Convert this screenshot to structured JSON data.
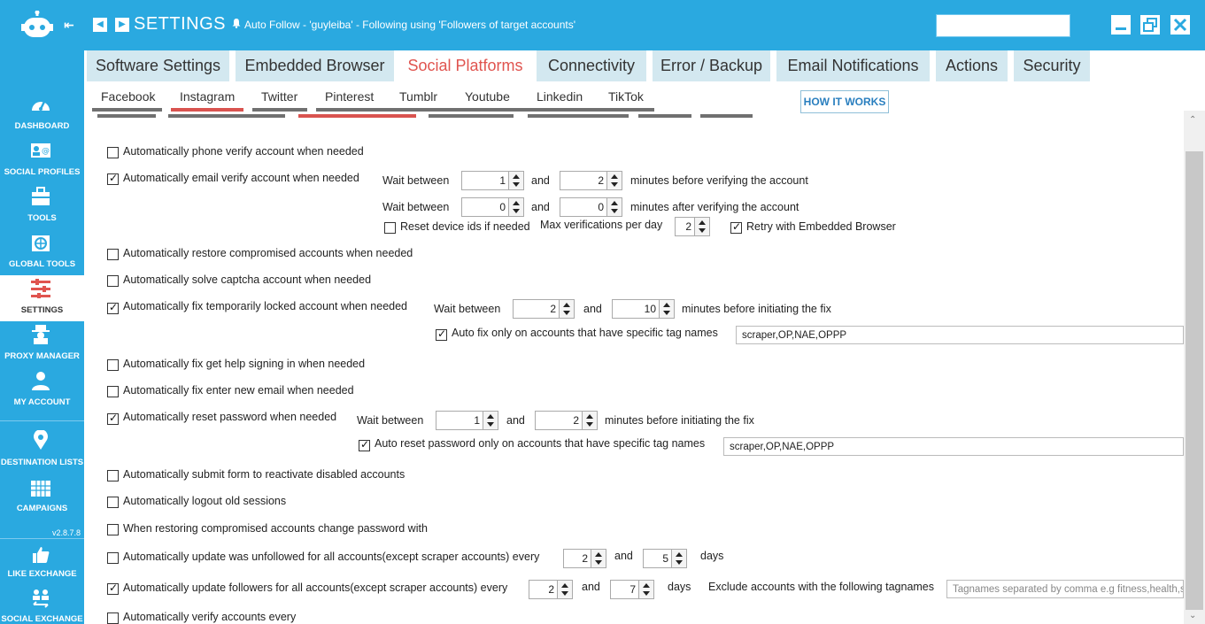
{
  "window": {
    "title": "SETTINGS",
    "status": "Auto Follow - 'guyleiba' - Following using 'Followers of target accounts'",
    "colors": {
      "accent": "#2aa9e0",
      "active_tab_text": "#e0544f",
      "tab_bg": "#d3e8f0",
      "underline_red": "#d9534f"
    }
  },
  "sidebar": {
    "version": "v2.8.7.8",
    "items": [
      {
        "label": "DASHBOARD",
        "icon": "dashboard-icon"
      },
      {
        "label": "SOCIAL PROFILES",
        "icon": "social-profiles-icon"
      },
      {
        "label": "TOOLS",
        "icon": "toolbox-icon"
      },
      {
        "label": "GLOBAL TOOLS",
        "icon": "globe-tools-icon"
      },
      {
        "label": "SETTINGS",
        "icon": "sliders-icon"
      },
      {
        "label": "PROXY MANAGER",
        "icon": "spy-icon"
      },
      {
        "label": "MY ACCOUNT",
        "icon": "user-icon"
      },
      {
        "label": "DESTINATION LISTS",
        "icon": "map-pin-icon"
      },
      {
        "label": "CAMPAIGNS",
        "icon": "calendar-icon"
      },
      {
        "label": "LIKE EXCHANGE",
        "icon": "thumbs-up-icon"
      },
      {
        "label": "SOCIAL EXCHANGE",
        "icon": "people-exchange-icon"
      }
    ]
  },
  "main_tabs": [
    "Software Settings",
    "Embedded Browser",
    "Social Platforms",
    "Connectivity",
    "Error / Backup",
    "Email Notifications",
    "Actions",
    "Security"
  ],
  "sub_tabs": [
    "Facebook",
    "Instagram",
    "Twitter",
    "Pinterest",
    "Tumblr",
    "Youtube",
    "Linkedin",
    "TikTok"
  ],
  "how_it_works": "HOW IT WORKS",
  "settings": {
    "phone_verify": {
      "label": "Automatically phone verify account when needed",
      "checked": false
    },
    "email_verify": {
      "label": "Automatically email verify account when needed",
      "checked": true,
      "wait_between": "Wait between",
      "and": "and",
      "before_min": "1",
      "before_max": "2",
      "before_text": "minutes before verifying the account",
      "after_min": "0",
      "after_max": "0",
      "after_text": "minutes after verifying the account",
      "reset_device_label": "Reset device ids if needed",
      "reset_device_checked": false,
      "max_verif_label": "Max verifications per day",
      "max_verif": "2",
      "retry_label": "Retry with Embedded Browser",
      "retry_checked": true
    },
    "restore_compromised": {
      "label": "Automatically restore compromised accounts when needed",
      "checked": false
    },
    "solve_captcha": {
      "label": "Automatically solve captcha account when needed",
      "checked": false
    },
    "fix_locked": {
      "label": "Automatically fix temporarily locked account when needed",
      "checked": true,
      "wait_between": "Wait between",
      "and": "and",
      "min": "2",
      "max": "10",
      "suffix": "minutes before initiating the fix",
      "tag_label": "Auto fix only on accounts that have specific tag names",
      "tag_checked": true,
      "tags": "scraper,OP,NAE,OPPP"
    },
    "fix_help_signing": {
      "label": "Automatically fix get help signing in when needed",
      "checked": false
    },
    "fix_new_email": {
      "label": "Automatically fix enter new email when needed",
      "checked": false
    },
    "reset_password": {
      "label": "Automatically reset password when needed",
      "checked": true,
      "wait_between": "Wait between",
      "and": "and",
      "min": "1",
      "max": "2",
      "suffix": "minutes before initiating the fix",
      "tag_label": "Auto reset password only on accounts that have specific tag names",
      "tag_checked": true,
      "tags": "scraper,OP,NAE,OPPP"
    },
    "submit_form": {
      "label": "Automatically submit form to reactivate disabled accounts",
      "checked": false
    },
    "logout_old": {
      "label": "Automatically logout old sessions",
      "checked": false
    },
    "change_password": {
      "label": "When restoring compromised accounts change password with",
      "checked": false
    },
    "update_unfollowed": {
      "label": "Automatically update was unfollowed for all accounts(except scraper accounts) every",
      "checked": false,
      "min": "2",
      "and": "and",
      "max": "5",
      "unit": "days"
    },
    "update_followers": {
      "label": "Automatically update followers for all accounts(except scraper accounts) every",
      "checked": true,
      "min": "2",
      "and": "and",
      "max": "7",
      "unit": "days",
      "exclude_label": "Exclude accounts with the following tagnames",
      "exclude_placeholder": "Tagnames separated by comma e.g fitness,health,s"
    },
    "verify_every": {
      "label": "Automatically verify accounts every",
      "checked": false
    }
  }
}
